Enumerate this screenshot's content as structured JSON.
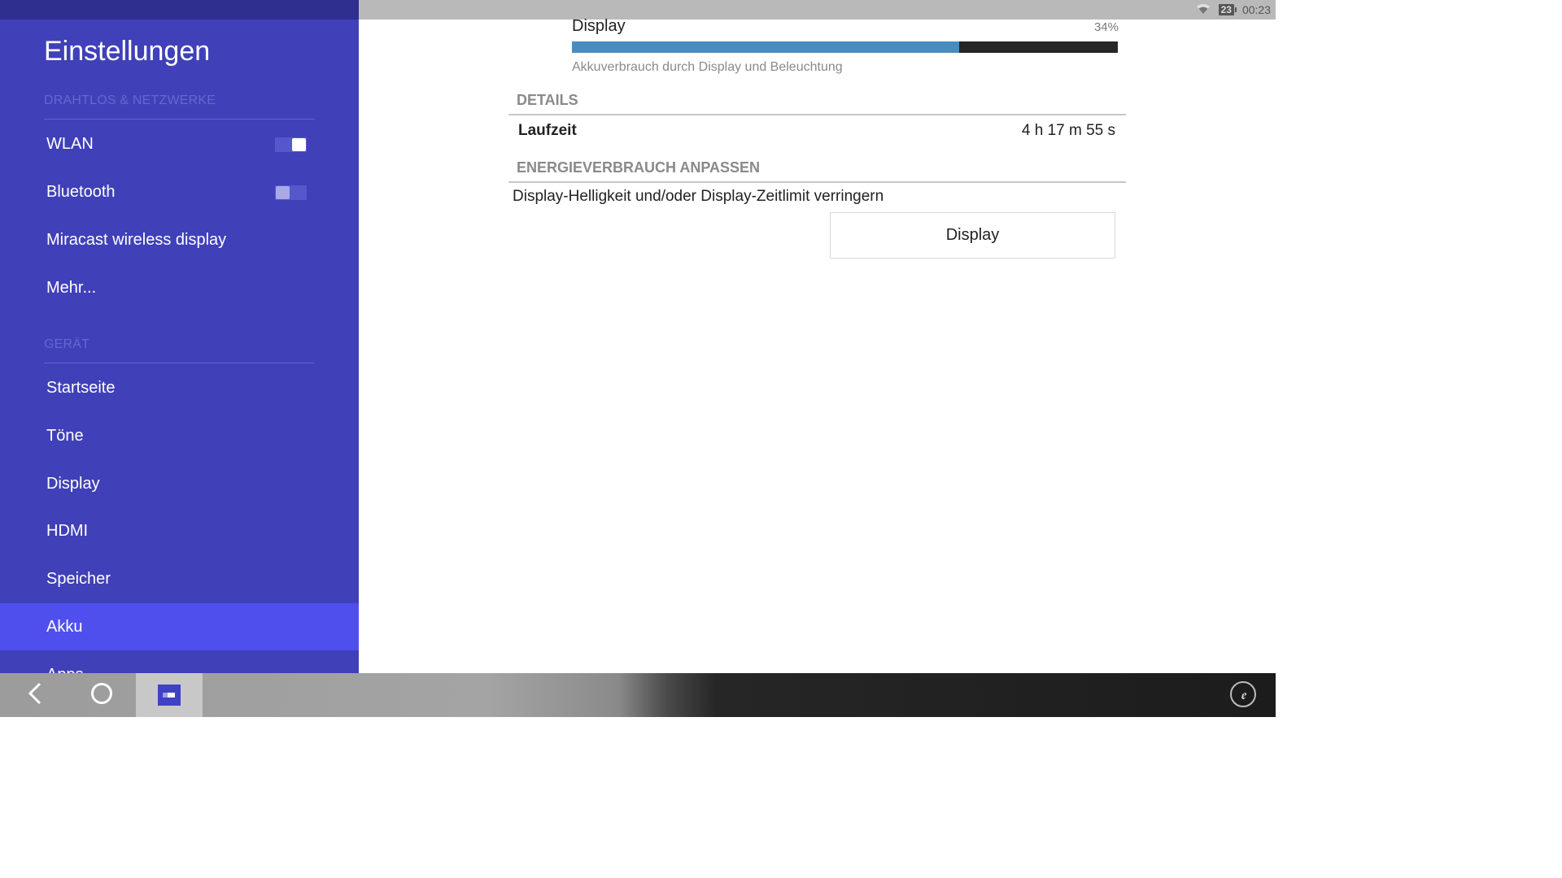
{
  "status_bar": {
    "battery_level": "23",
    "time": "00:23",
    "wifi_icon": "wifi-icon"
  },
  "sidebar": {
    "title": "Einstellungen",
    "sections": [
      {
        "header": "DRAHTLOS & NETZWERKE",
        "items": [
          {
            "label": "WLAN",
            "toggle": true
          },
          {
            "label": "Bluetooth",
            "toggle": false
          },
          {
            "label": "Miracast wireless display"
          },
          {
            "label": "Mehr..."
          }
        ]
      },
      {
        "header": "GERÄT",
        "items": [
          {
            "label": "Startseite"
          },
          {
            "label": "Töne"
          },
          {
            "label": "Display"
          },
          {
            "label": "HDMI"
          },
          {
            "label": "Speicher"
          },
          {
            "label": "Akku",
            "active": true
          },
          {
            "label": "Apps"
          }
        ]
      }
    ]
  },
  "usage": {
    "label": "Display",
    "percent_text": "34%",
    "bar_fill_fraction": 0.71,
    "description": "Akkuverbrauch durch Display und Beleuchtung"
  },
  "details": {
    "header": "DETAILS",
    "runtime_label": "Laufzeit",
    "runtime_value": "4 h 17 m 55 s"
  },
  "adjust": {
    "header": "ENERGIEVERBRAUCH ANPASSEN",
    "text": "Display-Helligkeit und/oder Display-Zeitlimit verringern",
    "button_label": "Display"
  },
  "colors": {
    "sidebar_bg": "#4040b8",
    "active_item": "#4f4fee",
    "usage_bar_fill": "#4a8cbe",
    "usage_bar_bg": "#262626"
  },
  "navbar": {
    "back_icon": "back-icon",
    "home_icon": "home-icon",
    "recents_icon": "recents-icon",
    "corner_icon": "app-launcher-icon"
  }
}
